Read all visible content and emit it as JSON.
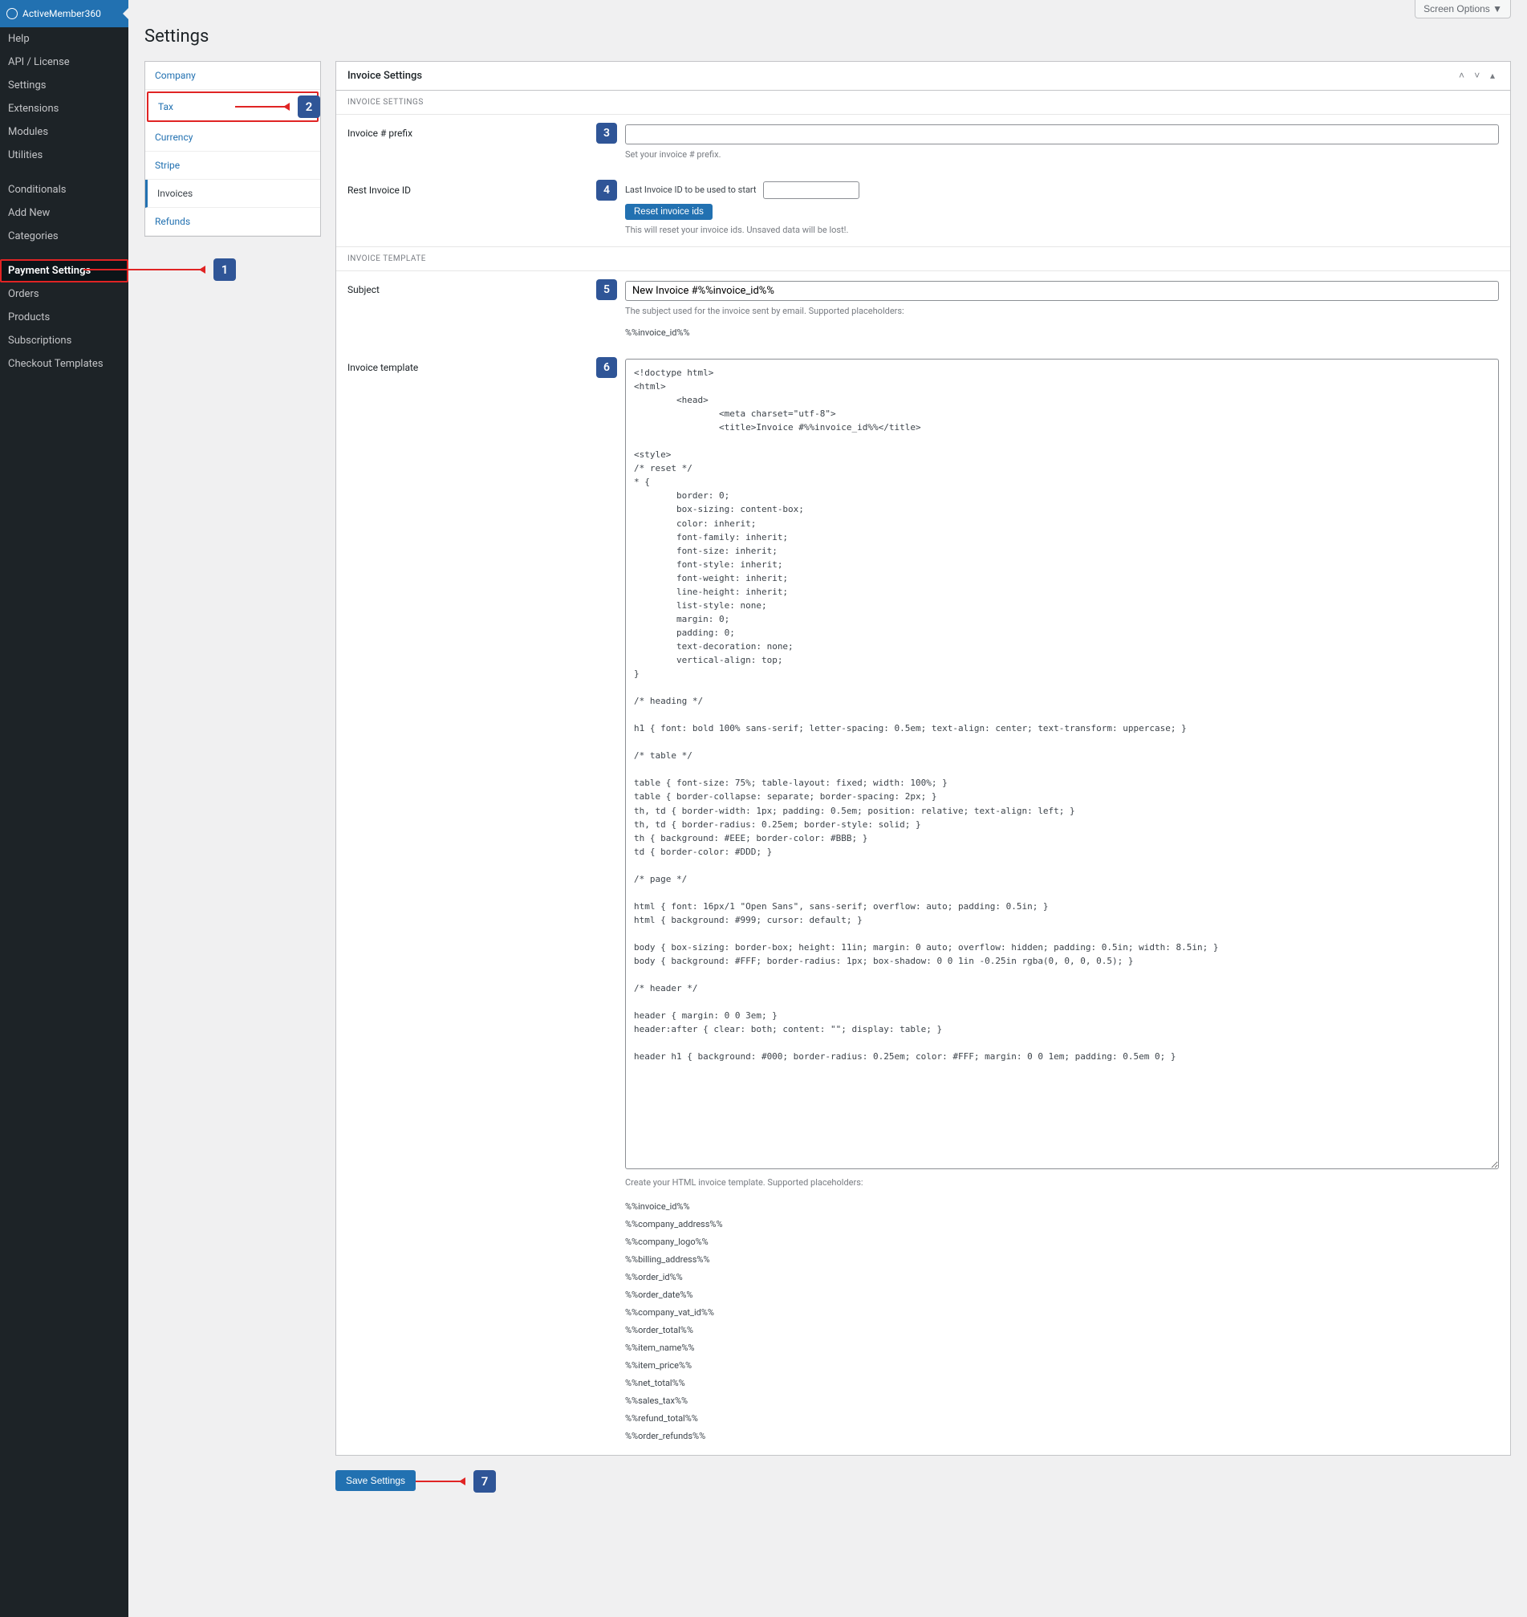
{
  "screen_options": "Screen Options ▼",
  "page_title": "Settings",
  "sidebar": {
    "brand": "ActiveMember360",
    "items": [
      {
        "label": "Help"
      },
      {
        "label": "API / License"
      },
      {
        "label": "Settings"
      },
      {
        "label": "Extensions"
      },
      {
        "label": "Modules"
      },
      {
        "label": "Utilities"
      }
    ],
    "items2": [
      {
        "label": "Conditionals"
      },
      {
        "label": "Add New"
      },
      {
        "label": "Categories"
      }
    ],
    "items3": [
      {
        "label": "Payment Settings",
        "active": true
      },
      {
        "label": "Orders"
      },
      {
        "label": "Products"
      },
      {
        "label": "Subscriptions"
      },
      {
        "label": "Checkout Templates"
      }
    ]
  },
  "tabs": {
    "items": [
      {
        "label": "Company"
      },
      {
        "label": "Tax"
      },
      {
        "label": "Currency"
      },
      {
        "label": "Stripe"
      },
      {
        "label": "Invoices",
        "active": true
      },
      {
        "label": "Refunds"
      }
    ]
  },
  "panel": {
    "title": "Invoice Settings",
    "sections": {
      "s1": "INVOICE SETTINGS",
      "s2": "INVOICE TEMPLATE"
    },
    "prefix": {
      "label": "Invoice # prefix",
      "value": "",
      "help": "Set your invoice # prefix."
    },
    "reset": {
      "label": "Rest Invoice ID",
      "inline_label": "Last Invoice ID to be used to start",
      "value": "",
      "button": "Reset invoice ids",
      "help": "This will reset your invoice ids. Unsaved data will be lost!."
    },
    "subject": {
      "label": "Subject",
      "value": "New Invoice #%%invoice_id%%",
      "help": "The subject used for the invoice sent by email. Supported placeholders:",
      "ph": "%%invoice_id%%"
    },
    "template": {
      "label": "Invoice template",
      "value": "<!doctype html>\n<html>\n\t<head>\n\t\t<meta charset=\"utf-8\">\n\t\t<title>Invoice #%%invoice_id%%</title>\n\n<style>\n/* reset */\n* {\n\tborder: 0;\n\tbox-sizing: content-box;\n\tcolor: inherit;\n\tfont-family: inherit;\n\tfont-size: inherit;\n\tfont-style: inherit;\n\tfont-weight: inherit;\n\tline-height: inherit;\n\tlist-style: none;\n\tmargin: 0;\n\tpadding: 0;\n\ttext-decoration: none;\n\tvertical-align: top;\n}\n\n/* heading */\n\nh1 { font: bold 100% sans-serif; letter-spacing: 0.5em; text-align: center; text-transform: uppercase; }\n\n/* table */\n\ntable { font-size: 75%; table-layout: fixed; width: 100%; }\ntable { border-collapse: separate; border-spacing: 2px; }\nth, td { border-width: 1px; padding: 0.5em; position: relative; text-align: left; }\nth, td { border-radius: 0.25em; border-style: solid; }\nth { background: #EEE; border-color: #BBB; }\ntd { border-color: #DDD; }\n\n/* page */\n\nhtml { font: 16px/1 \"Open Sans\", sans-serif; overflow: auto; padding: 0.5in; }\nhtml { background: #999; cursor: default; }\n\nbody { box-sizing: border-box; height: 11in; margin: 0 auto; overflow: hidden; padding: 0.5in; width: 8.5in; }\nbody { background: #FFF; border-radius: 1px; box-shadow: 0 0 1in -0.25in rgba(0, 0, 0, 0.5); }\n\n/* header */\n\nheader { margin: 0 0 3em; }\nheader:after { clear: both; content: \"\"; display: table; }\n\nheader h1 { background: #000; border-radius: 0.25em; color: #FFF; margin: 0 0 1em; padding: 0.5em 0; }",
      "help": "Create your HTML invoice template. Supported placeholders:",
      "placeholders": [
        "%%invoice_id%%",
        "%%company_address%%",
        "%%company_logo%%",
        "%%billing_address%%",
        "%%order_id%%",
        "%%order_date%%",
        "%%company_vat_id%%",
        "%%order_total%%",
        "%%item_name%%",
        "%%item_price%%",
        "%%net_total%%",
        "%%sales_tax%%",
        "%%refund_total%%",
        "%%order_refunds%%"
      ]
    }
  },
  "save_button": "Save Settings",
  "annotations": {
    "1": "1",
    "2": "2",
    "3": "3",
    "4": "4",
    "5": "5",
    "6": "6",
    "7": "7"
  }
}
